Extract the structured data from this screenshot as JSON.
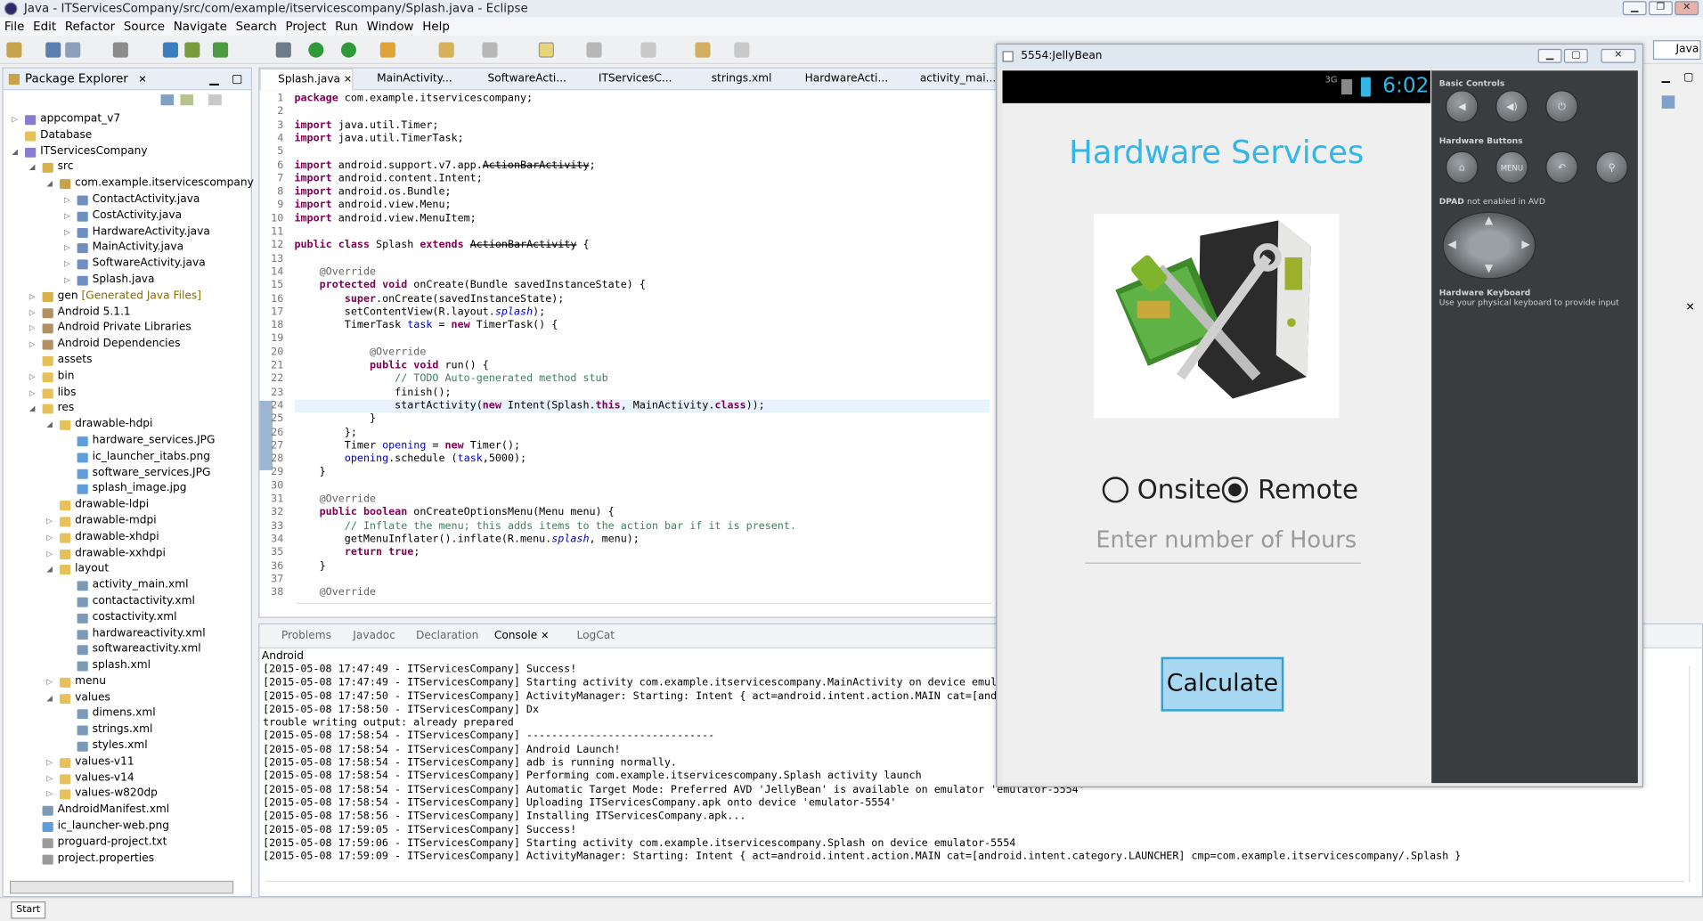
{
  "window": {
    "title": "Java - ITServicesCompany/src/com/example/itservicescompany/Splash.java - Eclipse",
    "perspective": "Java"
  },
  "menu": [
    "File",
    "Edit",
    "Refactor",
    "Source",
    "Navigate",
    "Search",
    "Project",
    "Run",
    "Window",
    "Help"
  ],
  "package_explorer": {
    "title": "Package Explorer",
    "items": [
      {
        "label": "appcompat_v7",
        "depth": 0,
        "arrow": "▷",
        "icon": "project"
      },
      {
        "label": "Database",
        "depth": 0,
        "arrow": "",
        "icon": "folder"
      },
      {
        "label": "ITServicesCompany",
        "depth": 0,
        "arrow": "◢",
        "icon": "project"
      },
      {
        "label": "src",
        "depth": 1,
        "arrow": "◢",
        "icon": "srcfolder"
      },
      {
        "label": "com.example.itservicescompany",
        "depth": 2,
        "arrow": "◢",
        "icon": "package"
      },
      {
        "label": "ContactActivity.java",
        "depth": 3,
        "arrow": "▷",
        "icon": "java"
      },
      {
        "label": "CostActivity.java",
        "depth": 3,
        "arrow": "▷",
        "icon": "java"
      },
      {
        "label": "HardwareActivity.java",
        "depth": 3,
        "arrow": "▷",
        "icon": "java"
      },
      {
        "label": "MainActivity.java",
        "depth": 3,
        "arrow": "▷",
        "icon": "java"
      },
      {
        "label": "SoftwareActivity.java",
        "depth": 3,
        "arrow": "▷",
        "icon": "java"
      },
      {
        "label": "Splash.java",
        "depth": 3,
        "arrow": "▷",
        "icon": "java"
      },
      {
        "label": "gen",
        "suffix": "[Generated Java Files]",
        "depth": 1,
        "arrow": "▷",
        "icon": "srcfolder"
      },
      {
        "label": "Android 5.1.1",
        "depth": 1,
        "arrow": "▷",
        "icon": "library"
      },
      {
        "label": "Android Private Libraries",
        "depth": 1,
        "arrow": "▷",
        "icon": "library"
      },
      {
        "label": "Android Dependencies",
        "depth": 1,
        "arrow": "▷",
        "icon": "library"
      },
      {
        "label": "assets",
        "depth": 1,
        "arrow": "",
        "icon": "folder"
      },
      {
        "label": "bin",
        "depth": 1,
        "arrow": "▷",
        "icon": "folder"
      },
      {
        "label": "libs",
        "depth": 1,
        "arrow": "▷",
        "icon": "folder"
      },
      {
        "label": "res",
        "depth": 1,
        "arrow": "◢",
        "icon": "folder"
      },
      {
        "label": "drawable-hdpi",
        "depth": 2,
        "arrow": "◢",
        "icon": "folder"
      },
      {
        "label": "hardware_services.JPG",
        "depth": 3,
        "arrow": "",
        "icon": "image"
      },
      {
        "label": "ic_launcher_itabs.png",
        "depth": 3,
        "arrow": "",
        "icon": "image"
      },
      {
        "label": "software_services.JPG",
        "depth": 3,
        "arrow": "",
        "icon": "image"
      },
      {
        "label": "splash_image.jpg",
        "depth": 3,
        "arrow": "",
        "icon": "image"
      },
      {
        "label": "drawable-ldpi",
        "depth": 2,
        "arrow": "",
        "icon": "folder"
      },
      {
        "label": "drawable-mdpi",
        "depth": 2,
        "arrow": "▷",
        "icon": "folder"
      },
      {
        "label": "drawable-xhdpi",
        "depth": 2,
        "arrow": "▷",
        "icon": "folder"
      },
      {
        "label": "drawable-xxhdpi",
        "depth": 2,
        "arrow": "▷",
        "icon": "folder"
      },
      {
        "label": "layout",
        "depth": 2,
        "arrow": "◢",
        "icon": "folder"
      },
      {
        "label": "activity_main.xml",
        "depth": 3,
        "arrow": "",
        "icon": "xml"
      },
      {
        "label": "contactactivity.xml",
        "depth": 3,
        "arrow": "",
        "icon": "xml"
      },
      {
        "label": "costactivity.xml",
        "depth": 3,
        "arrow": "",
        "icon": "xml"
      },
      {
        "label": "hardwareactivity.xml",
        "depth": 3,
        "arrow": "",
        "icon": "xml"
      },
      {
        "label": "softwareactivity.xml",
        "depth": 3,
        "arrow": "",
        "icon": "xml"
      },
      {
        "label": "splash.xml",
        "depth": 3,
        "arrow": "",
        "icon": "xml"
      },
      {
        "label": "menu",
        "depth": 2,
        "arrow": "▷",
        "icon": "folder"
      },
      {
        "label": "values",
        "depth": 2,
        "arrow": "◢",
        "icon": "folder"
      },
      {
        "label": "dimens.xml",
        "depth": 3,
        "arrow": "",
        "icon": "xml"
      },
      {
        "label": "strings.xml",
        "depth": 3,
        "arrow": "",
        "icon": "xml"
      },
      {
        "label": "styles.xml",
        "depth": 3,
        "arrow": "",
        "icon": "xml"
      },
      {
        "label": "values-v11",
        "depth": 2,
        "arrow": "▷",
        "icon": "folder"
      },
      {
        "label": "values-v14",
        "depth": 2,
        "arrow": "▷",
        "icon": "folder"
      },
      {
        "label": "values-w820dp",
        "depth": 2,
        "arrow": "▷",
        "icon": "folder"
      },
      {
        "label": "AndroidManifest.xml",
        "depth": 1,
        "arrow": "",
        "icon": "xml"
      },
      {
        "label": "ic_launcher-web.png",
        "depth": 1,
        "arrow": "",
        "icon": "image"
      },
      {
        "label": "proguard-project.txt",
        "depth": 1,
        "arrow": "",
        "icon": "file"
      },
      {
        "label": "project.properties",
        "depth": 1,
        "arrow": "",
        "icon": "file"
      }
    ]
  },
  "editor": {
    "tabs": [
      "Splash.java",
      "MainActivity...",
      "SoftwareActi...",
      "ITServicesC...",
      "strings.xml",
      "HardwareActi...",
      "activity_mai..."
    ],
    "lines": [
      {
        "n": "1",
        "html": "<span class=\"kw\">package</span> com.example.itservicescompany;"
      },
      {
        "n": "2",
        "html": ""
      },
      {
        "n": "3",
        "html": "<span class=\"kw\">import</span> java.util.Timer;"
      },
      {
        "n": "4",
        "html": "<span class=\"kw\">import</span> java.util.TimerTask;"
      },
      {
        "n": "5",
        "html": ""
      },
      {
        "n": "6",
        "html": "<span class=\"kw\">import</span> android.support.v7.app.<span class=\"dep\">ActionBarActivity</span>;"
      },
      {
        "n": "7",
        "html": "<span class=\"kw\">import</span> android.content.Intent;"
      },
      {
        "n": "8",
        "html": "<span class=\"kw\">import</span> android.os.Bundle;"
      },
      {
        "n": "9",
        "html": "<span class=\"kw\">import</span> android.view.Menu;"
      },
      {
        "n": "10",
        "html": "<span class=\"kw\">import</span> android.view.MenuItem;"
      },
      {
        "n": "11",
        "html": ""
      },
      {
        "n": "12",
        "html": "<span class=\"kw\">public class</span> Splash <span class=\"kw\">extends</span> <span class=\"dep\">ActionBarActivity</span> {"
      },
      {
        "n": "13",
        "html": ""
      },
      {
        "n": "14",
        "html": "    <span class=\"an\">@Override</span>"
      },
      {
        "n": "15",
        "html": "    <span class=\"kw\">protected void</span> onCreate(Bundle savedInstanceState) {"
      },
      {
        "n": "16",
        "html": "        <span class=\"kw\">super</span>.onCreate(savedInstanceState);"
      },
      {
        "n": "17",
        "html": "        setContentView(R.layout.<span class=\"st\">splash</span>);"
      },
      {
        "n": "18",
        "html": "        TimerTask <span class=\"fd\">task</span> = <span class=\"kw\">new</span> TimerTask() {"
      },
      {
        "n": "19",
        "html": ""
      },
      {
        "n": "20",
        "html": "            <span class=\"an\">@Override</span>"
      },
      {
        "n": "21",
        "html": "            <span class=\"kw\">public void</span> run() {"
      },
      {
        "n": "22",
        "html": "                <span class=\"cm\">// TODO Auto-generated method stub</span>"
      },
      {
        "n": "23",
        "html": "                finish();"
      },
      {
        "n": "24",
        "html": "                startActivity(<span class=\"kw\">new</span> Intent(Splash.<span class=\"kw\">this</span>, MainActivity.<span class=\"kw\">class</span>));"
      },
      {
        "n": "25",
        "html": "            }"
      },
      {
        "n": "26",
        "html": "        };"
      },
      {
        "n": "27",
        "html": "        Timer <span class=\"fd\">opening</span> = <span class=\"kw\">new</span> Timer();"
      },
      {
        "n": "28",
        "html": "        <span class=\"fd\">opening</span>.schedule (<span class=\"fd\">task</span>,5000);"
      },
      {
        "n": "29",
        "html": "    }"
      },
      {
        "n": "30",
        "html": ""
      },
      {
        "n": "31",
        "html": "    <span class=\"an\">@Override</span>"
      },
      {
        "n": "32",
        "html": "    <span class=\"kw\">public boolean</span> onCreateOptionsMenu(Menu menu) {"
      },
      {
        "n": "33",
        "html": "        <span class=\"cm\">// Inflate the menu; this adds items to the action bar if it is present.</span>"
      },
      {
        "n": "34",
        "html": "        getMenuInflater().inflate(R.menu.<span class=\"st\">splash</span>, menu);"
      },
      {
        "n": "35",
        "html": "        <span class=\"kw\">return true</span>;"
      },
      {
        "n": "36",
        "html": "    }"
      },
      {
        "n": "37",
        "html": ""
      },
      {
        "n": "38",
        "html": "    <span class=\"an\">@Override</span>"
      }
    ]
  },
  "console": {
    "tabs": [
      "Problems",
      "Javadoc",
      "Declaration",
      "Console",
      "LogCat"
    ],
    "active_tab": "Console",
    "label": "Android",
    "lines": [
      "[2015-05-08 17:47:49 - ITServicesCompany] Success!",
      "[2015-05-08 17:47:49 - ITServicesCompany] Starting activity com.example.itservicescompany.MainActivity on device emula",
      "[2015-05-08 17:47:50 - ITServicesCompany] ActivityManager: Starting: Intent { act=android.intent.action.MAIN cat=[andro",
      "[2015-05-08 17:58:50 - ITServicesCompany] Dx",
      "trouble writing output: already prepared",
      "[2015-05-08 17:58:54 - ITServicesCompany] ------------------------------",
      "[2015-05-08 17:58:54 - ITServicesCompany] Android Launch!",
      "[2015-05-08 17:58:54 - ITServicesCompany] adb is running normally.",
      "[2015-05-08 17:58:54 - ITServicesCompany] Performing com.example.itservicescompany.Splash activity launch",
      "[2015-05-08 17:58:54 - ITServicesCompany] Automatic Target Mode: Preferred AVD 'JellyBean' is available on emulator 'emulator-5554'",
      "[2015-05-08 17:58:54 - ITServicesCompany] Uploading ITServicesCompany.apk onto device 'emulator-5554'",
      "[2015-05-08 17:58:56 - ITServicesCompany] Installing ITServicesCompany.apk...",
      "[2015-05-08 17:59:05 - ITServicesCompany] Success!",
      "[2015-05-08 17:59:06 - ITServicesCompany] Starting activity com.example.itservicescompany.Splash on device emulator-5554",
      "[2015-05-08 17:59:09 - ITServicesCompany] ActivityManager: Starting: Intent { act=android.intent.action.MAIN cat=[android.intent.category.LAUNCHER] cmp=com.example.itservicescompany/.Splash }"
    ]
  },
  "emulator": {
    "title": "5554:JellyBean",
    "status": {
      "network": "3G",
      "time": "6:02"
    },
    "app": {
      "heading": "Hardware Services",
      "radio_onsite": "Onsite",
      "radio_remote": "Remote",
      "selected": "Remote",
      "hours_placeholder": "Enter number of Hours",
      "calculate": "Calculate"
    },
    "controls": {
      "basic_title": "Basic Controls",
      "hw_title": "Hardware Buttons",
      "menu_label": "MENU",
      "dpad_title": "DPAD",
      "dpad_note": "not enabled in AVD",
      "kbd_title": "Hardware Keyboard",
      "kbd_note": "Use your physical keyboard to provide input"
    }
  },
  "taskbar": {
    "start": "Start"
  },
  "colors": {
    "accent": "#33b5e5",
    "keyword": "#7f0055",
    "comment": "#3f7f5f"
  }
}
